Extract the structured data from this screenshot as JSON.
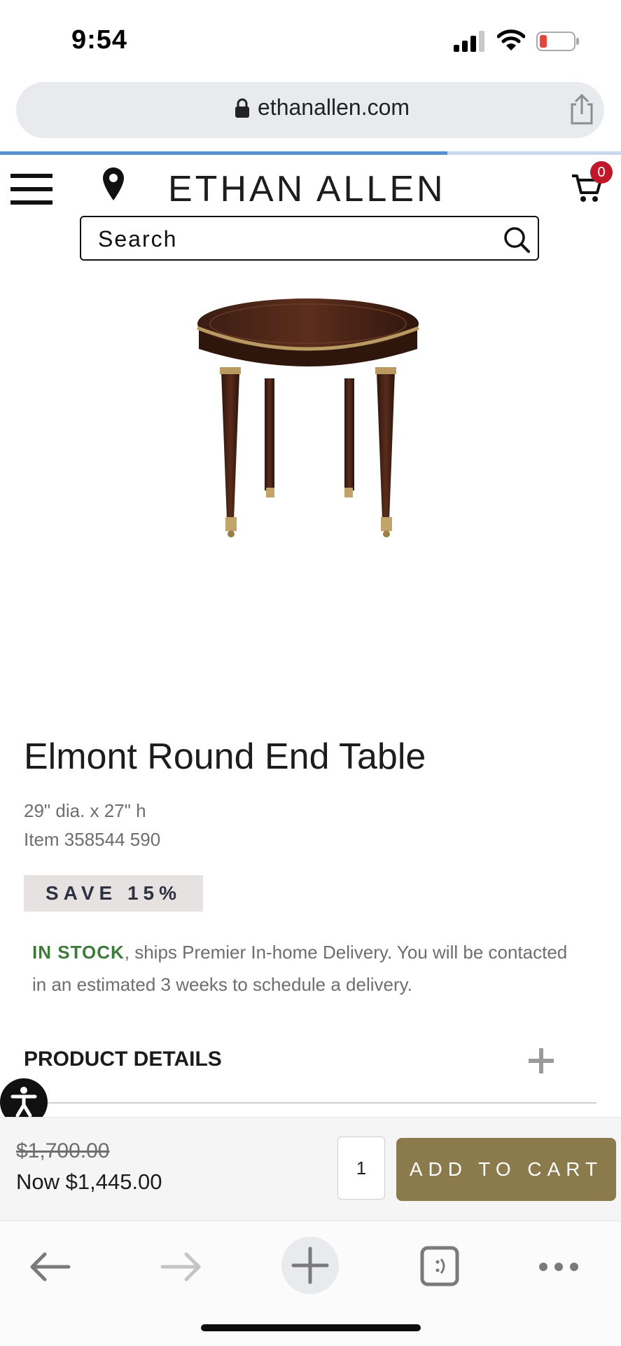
{
  "status_bar": {
    "time": "9:54",
    "battery_color": "#e5463b"
  },
  "browser": {
    "url": "ethanallen.com",
    "load_progress": 0.72,
    "icons": {
      "lock": "lock-icon",
      "share": "share-icon",
      "back": "arrow-left-icon",
      "forward": "arrow-right-icon",
      "new_tab": "plus-icon",
      "tabs": "tabs-icon",
      "more": "more-icon"
    }
  },
  "header": {
    "brand": "ETHAN ALLEN",
    "cart_count": "0",
    "icons": {
      "menu": "hamburger-menu-icon",
      "location": "map-pin-icon",
      "cart": "cart-icon"
    }
  },
  "search": {
    "placeholder": "Search"
  },
  "product": {
    "title": "Elmont Round End Table",
    "dimensions": "29\" dia. x 27\" h",
    "item": "Item 358544 590",
    "badge": "SAVE 15%",
    "stock_label": "IN STOCK",
    "stock_text": ", ships Premier In-home Delivery. You will be contacted in an estimated 3 weeks to schedule a delivery.",
    "details_label": "PRODUCT DETAILS"
  },
  "purchase": {
    "price_was": "$1,700.00",
    "price_now": "Now $1,445.00",
    "quantity": "1",
    "add_to_cart": "ADD TO CART"
  },
  "colors": {
    "accent_gold": "#8a7a4c",
    "in_stock_green": "#3f7a3a",
    "cart_badge_red": "#c0182a",
    "progress_blue": "#5b8fd3"
  }
}
